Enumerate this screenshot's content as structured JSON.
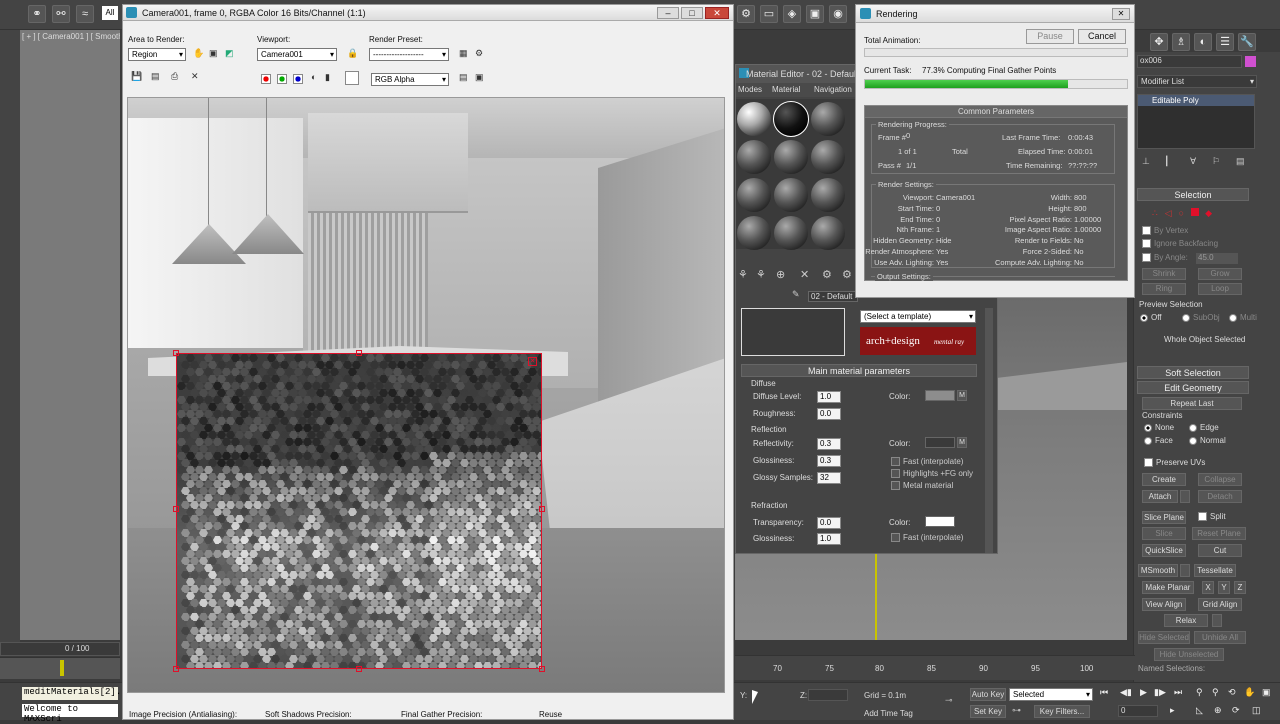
{
  "max_toolbar": {
    "all_label": "All"
  },
  "viewport_label": "[ + ] [ Camera001 ] [ Smooth",
  "timeline": {
    "frame_counter": "0 / 100",
    "ticks": [
      "70",
      "75",
      "80",
      "85",
      "90",
      "95",
      "100"
    ]
  },
  "status": {
    "script_line1": "meditMaterials[2].",
    "script_line2": "Welcome to MAXScri",
    "y_label": "Y:",
    "z_label": "Z:",
    "grid": "Grid = 0.1m",
    "auto_key": "Auto Key",
    "set_key": "Set Key",
    "selected": "Selected",
    "key_filters": "Key Filters...",
    "add_time_tag": "Add Time Tag",
    "frame_field": "0"
  },
  "frame_window": {
    "title": "Camera001, frame 0, RGBA Color 16 Bits/Channel (1:1)",
    "area_label": "Area to Render:",
    "area_value": "Region",
    "viewport_label": "Viewport:",
    "viewport_value": "Camera001",
    "preset_label": "Render Preset:",
    "preset_value": "-------------------",
    "channel_value": "RGB Alpha",
    "bottom": {
      "image_precision": "Image Precision (Antialiasing):",
      "soft_shadows": "Soft Shadows Precision:",
      "final_gather": "Final Gather Precision:",
      "reuse": "Reuse"
    }
  },
  "material_editor": {
    "title": "Material Editor - 02 - Default",
    "menu": [
      "Modes",
      "Material",
      "Navigation"
    ],
    "mat_name": "02 - Default",
    "template": "(Select a template)",
    "brand": "arch+design",
    "brand_sub": "mental ray",
    "main_params": "Main material parameters",
    "diffuse": {
      "header": "Diffuse",
      "level_label": "Diffuse Level:",
      "level": "1.0",
      "roughness_label": "Roughness:",
      "roughness": "0.0",
      "color_label": "Color:"
    },
    "reflection": {
      "header": "Reflection",
      "reflectivity_label": "Reflectivity:",
      "reflectivity": "0.3",
      "glossiness_label": "Glossiness:",
      "glossiness": "0.3",
      "samples_label": "Glossy Samples:",
      "samples": "32",
      "color_label": "Color:",
      "fast": "Fast (interpolate)",
      "highlights": "Highlights +FG only",
      "metal": "Metal material"
    },
    "refraction": {
      "header": "Refraction",
      "transparency_label": "Transparency:",
      "transparency": "0.0",
      "glossiness_label": "Glossiness:",
      "glossiness": "1.0",
      "color_label": "Color:",
      "fast": "Fast (interpolate)"
    }
  },
  "rendering": {
    "title": "Rendering",
    "pause": "Pause",
    "cancel": "Cancel",
    "total_animation": "Total Animation:",
    "current_task_label": "Current Task:",
    "current_task": "77.3%  Computing Final Gather Points",
    "current_progress": 0.773,
    "common": "Common Parameters",
    "progress_group": "Rendering Progress:",
    "frame_label": "Frame #",
    "frame": "0",
    "of": "1 of 1",
    "total": "Total",
    "pass_label": "Pass #",
    "pass": "1/1",
    "last_frame_label": "Last Frame Time:",
    "last_frame": "0:00:43",
    "elapsed_label": "Elapsed Time:",
    "elapsed": "0:00:01",
    "remaining_label": "Time Remaining:",
    "remaining": "??:??:??",
    "settings_group": "Render Settings:",
    "left_rows": [
      [
        "Viewport:",
        "Camera001"
      ],
      [
        "Start Time:",
        "0"
      ],
      [
        "End Time:",
        "0"
      ],
      [
        "Nth Frame:",
        "1"
      ],
      [
        "Hidden Geometry:",
        "Hide"
      ],
      [
        "Render Atmosphere:",
        "Yes"
      ],
      [
        "Use Adv. Lighting:",
        "Yes"
      ]
    ],
    "right_rows": [
      [
        "Width:",
        "800"
      ],
      [
        "Height:",
        "800"
      ],
      [
        "Pixel Aspect Ratio:",
        "1.00000"
      ],
      [
        "Image Aspect Ratio:",
        "1.00000"
      ],
      [
        "Render to Fields:",
        "No"
      ],
      [
        "Force 2-Sided:",
        "No"
      ],
      [
        "Compute Adv. Lighting:",
        "No"
      ]
    ],
    "output_group": "Output Settings:"
  },
  "command_panel": {
    "object_name": "ox006",
    "modifier_list": "Modifier List",
    "stack_item": "Editable Poly",
    "selection": "Selection",
    "by_vertex": "By Vertex",
    "ignore_backfacing": "Ignore Backfacing",
    "by_angle": "By Angle:",
    "angle": "45.0",
    "shrink": "Shrink",
    "grow": "Grow",
    "ring": "Ring",
    "loop": "Loop",
    "preview_selection": "Preview Selection",
    "preview_opts": [
      "Off",
      "SubObj",
      "Multi"
    ],
    "whole_object": "Whole Object Selected",
    "soft_selection": "Soft Selection",
    "edit_geometry": "Edit Geometry",
    "repeat_last": "Repeat Last",
    "constraints": "Constraints",
    "constraint_opts": [
      "None",
      "Edge",
      "Face",
      "Normal"
    ],
    "preserve_uvs": "Preserve UVs",
    "create": "Create",
    "collapse": "Collapse",
    "attach": "Attach",
    "detach": "Detach",
    "slice_plane": "Slice Plane",
    "split": "Split",
    "slice": "Slice",
    "reset_plane": "Reset Plane",
    "quickslice": "QuickSlice",
    "cut": "Cut",
    "msmooth": "MSmooth",
    "tessellate": "Tessellate",
    "make_planar": "Make Planar",
    "x": "X",
    "y": "Y",
    "z": "Z",
    "view_align": "View Align",
    "grid_align": "Grid Align",
    "relax": "Relax",
    "hide_selected": "Hide Selected",
    "unhide_all": "Unhide All",
    "hide_unselected": "Hide Unselected",
    "named_selections": "Named Selections:"
  },
  "colors": {
    "accent_red": "#c0001a",
    "progress_green": "#22b022",
    "selection_red": "#e0102a"
  }
}
